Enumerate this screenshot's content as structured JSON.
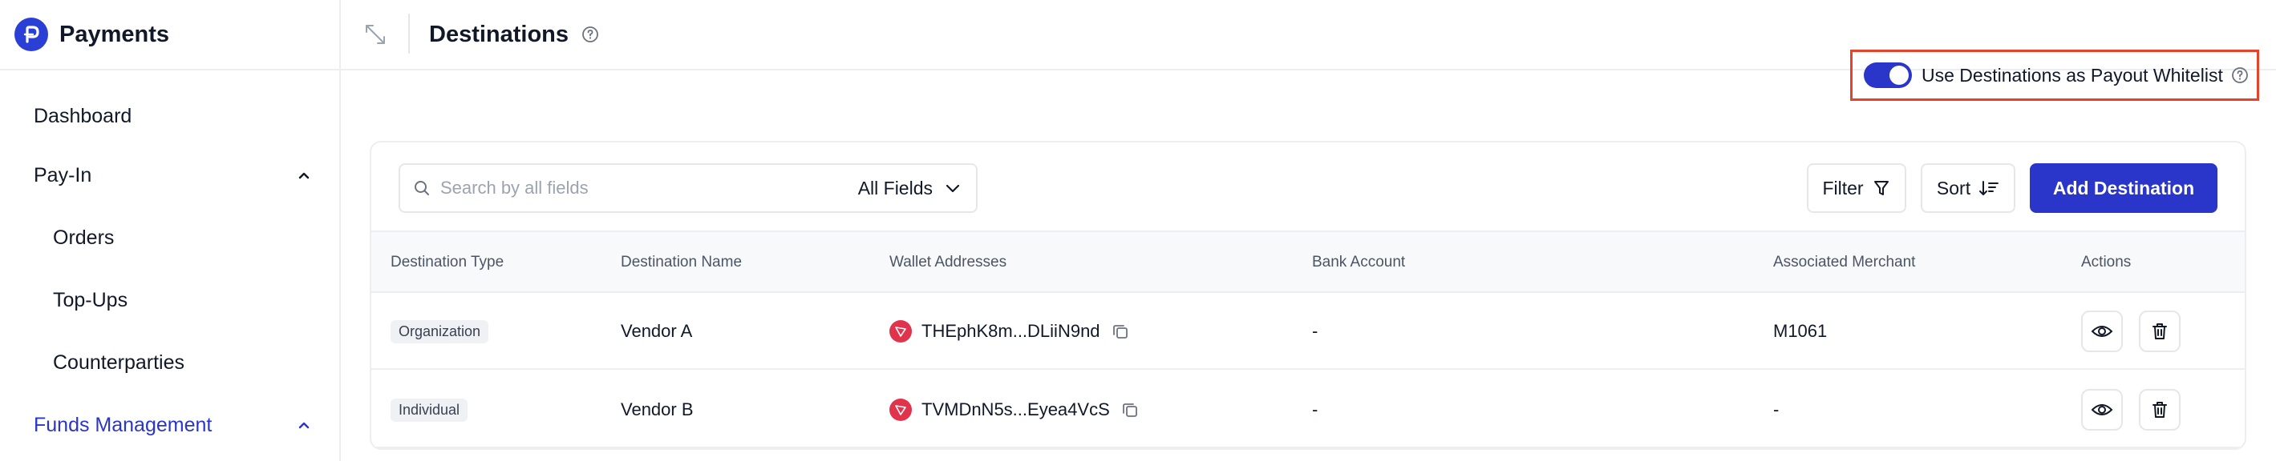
{
  "brand": {
    "name": "Payments"
  },
  "sidebar": {
    "items": [
      {
        "label": "Dashboard"
      },
      {
        "label": "Pay-In"
      },
      {
        "label": "Orders"
      },
      {
        "label": "Top-Ups"
      },
      {
        "label": "Counterparties"
      },
      {
        "label": "Funds Management"
      }
    ]
  },
  "header": {
    "title": "Destinations"
  },
  "whitelist": {
    "label": "Use Destinations as Payout Whitelist",
    "enabled": true
  },
  "search": {
    "placeholder": "Search by all fields",
    "field": "All Fields"
  },
  "toolbar": {
    "filter_label": "Filter",
    "sort_label": "Sort",
    "add_label": "Add Destination"
  },
  "table": {
    "columns": [
      "Destination Type",
      "Destination Name",
      "Wallet Addresses",
      "Bank Account",
      "Associated Merchant",
      "Actions"
    ],
    "rows": [
      {
        "type": "Organization",
        "name": "Vendor A",
        "wallet": "THEphK8m...DLiiN9nd",
        "bank": "-",
        "merchant": "M1061"
      },
      {
        "type": "Individual",
        "name": "Vendor B",
        "wallet": "TVMDnN5s...Eyea4VcS",
        "bank": "-",
        "merchant": "-"
      }
    ]
  },
  "colors": {
    "accent": "#2a35c9",
    "highlight": "#e5432b",
    "tron": "#e2334d"
  }
}
